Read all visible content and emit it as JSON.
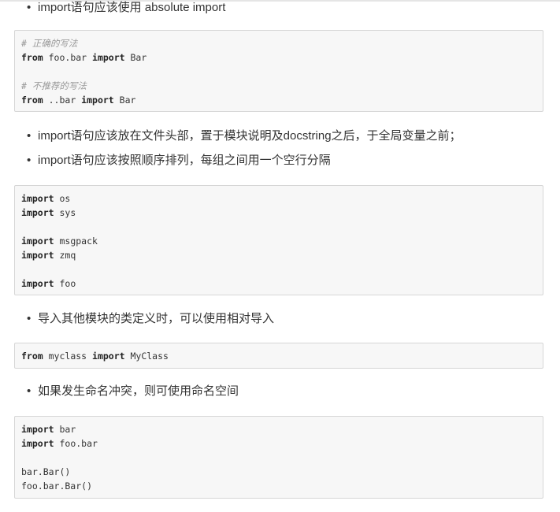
{
  "bullets": [
    "import语句应该使用 absolute import",
    "import语句应该放在文件头部，置于模块说明及docstring之后，于全局变量之前；",
    "import语句应该按照顺序排列，每组之间用一个空行分隔",
    "导入其他模块的类定义时，可以使用相对导入",
    "如果发生命名冲突，则可使用命名空间"
  ],
  "code_blocks": [
    [
      [
        {
          "t": "# 正确的写法",
          "c": "cm"
        }
      ],
      [
        {
          "t": "from",
          "c": "kw"
        },
        {
          "t": " foo.bar "
        },
        {
          "t": "import",
          "c": "kw"
        },
        {
          "t": " Bar"
        }
      ],
      [],
      [
        {
          "t": "# 不推荐的写法",
          "c": "cm"
        }
      ],
      [
        {
          "t": "from",
          "c": "kw"
        },
        {
          "t": " ..bar "
        },
        {
          "t": "import",
          "c": "kw"
        },
        {
          "t": " Bar"
        }
      ]
    ],
    [
      [
        {
          "t": "import",
          "c": "kw"
        },
        {
          "t": " os"
        }
      ],
      [
        {
          "t": "import",
          "c": "kw"
        },
        {
          "t": " sys"
        }
      ],
      [],
      [
        {
          "t": "import",
          "c": "kw"
        },
        {
          "t": " msgpack"
        }
      ],
      [
        {
          "t": "import",
          "c": "kw"
        },
        {
          "t": " zmq"
        }
      ],
      [],
      [
        {
          "t": "import",
          "c": "kw"
        },
        {
          "t": " foo"
        }
      ]
    ],
    [
      [
        {
          "t": "from",
          "c": "kw"
        },
        {
          "t": " myclass "
        },
        {
          "t": "import",
          "c": "kw"
        },
        {
          "t": " MyClass"
        }
      ]
    ],
    [
      [
        {
          "t": "import",
          "c": "kw"
        },
        {
          "t": " bar"
        }
      ],
      [
        {
          "t": "import",
          "c": "kw"
        },
        {
          "t": " foo.bar"
        }
      ],
      [],
      [
        {
          "t": "bar.Bar()"
        }
      ],
      [
        {
          "t": "foo.bar.Bar()"
        }
      ]
    ]
  ]
}
